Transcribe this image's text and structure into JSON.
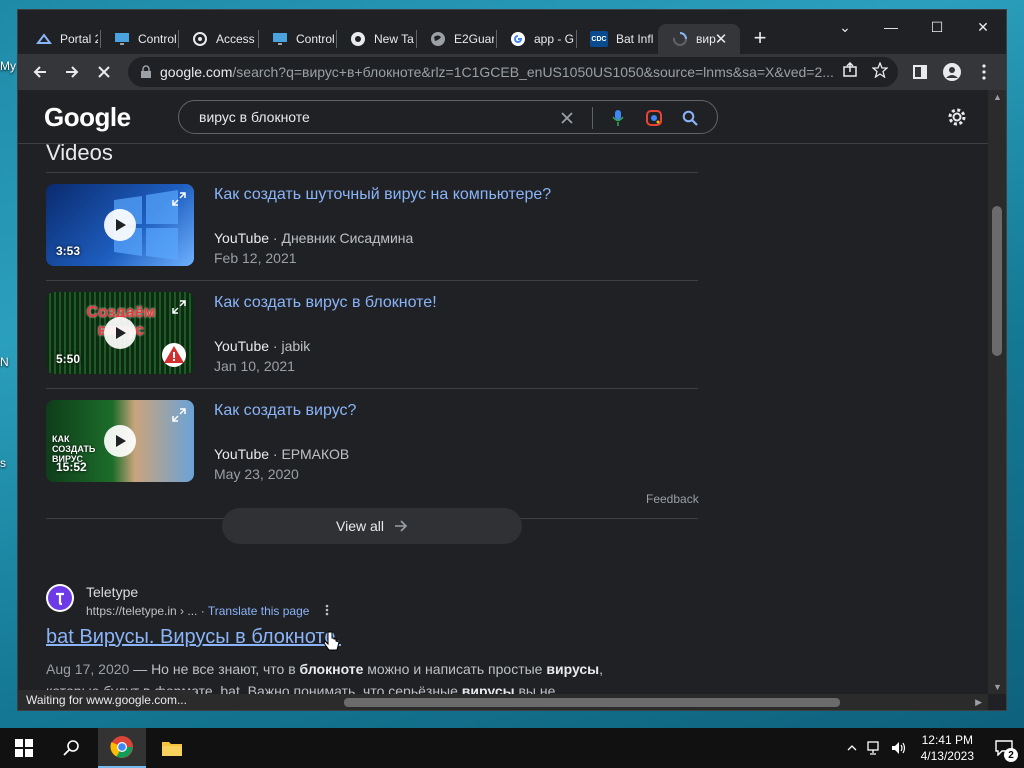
{
  "desktop": {
    "frag_1": "My",
    "frag_2": "N",
    "frag_3": "s"
  },
  "tabs": [
    {
      "label": "Portal 2",
      "icon": "portal-icon"
    },
    {
      "label": "Control",
      "icon": "monitor-icon"
    },
    {
      "label": "Access",
      "icon": "access-icon"
    },
    {
      "label": "Control",
      "icon": "monitor-icon"
    },
    {
      "label": "New Ta",
      "icon": "chrome-icon"
    },
    {
      "label": "E2Guar",
      "icon": "globe-icon"
    },
    {
      "label": "app - G",
      "icon": "google-g-icon"
    },
    {
      "label": "Bat Infl",
      "icon": "cdc-icon",
      "icon_text": "CDC"
    },
    {
      "label": "вир",
      "icon": "loading-spinner-icon",
      "active": true
    }
  ],
  "window": {
    "minimize_symbol": "—",
    "maximize_symbol": "☐",
    "close_symbol": "✕",
    "tablist_symbol": "⌄"
  },
  "toolbar": {
    "url_host": "google.com",
    "url_rest": "/search?q=вирус+в+блокноте&rlz=1C1GCEB_enUS1050US1050&source=lnms&sa=X&ved=2..."
  },
  "google": {
    "logo": "Google",
    "query": "вирус в блокноте",
    "videos_heading": "Videos"
  },
  "videos": [
    {
      "title": "Как создать шуточный вирус на компьютере?",
      "source": "YouTube",
      "channel": "Дневник Сисадмина",
      "date": "Feb 12, 2021",
      "duration": "3:53"
    },
    {
      "title": "Как создать вирус в блокноте!",
      "source": "YouTube",
      "channel": "jabik",
      "date": "Jan 10, 2021",
      "duration": "5:50",
      "thumb_text": "Создаём вирус"
    },
    {
      "title": "Как создать вирус?",
      "source": "YouTube",
      "channel": "ЕРМАКОВ",
      "date": "May 23, 2020",
      "duration": "15:52",
      "thumb_text": "КАК СОЗДАТЬ ВИРУС"
    }
  ],
  "feedback": "Feedback",
  "view_all": "View all",
  "result": {
    "site": "Teletype",
    "url": "https://teletype.in › ...",
    "translate": "Translate this page",
    "title": "bat Вирусы. Вирусы в блокноте.",
    "date": "Aug 17, 2020",
    "snip_a": " — Но не все знают, что в ",
    "snip_b1": "блокноте",
    "snip_c": " можно и написать простые ",
    "snip_b2": "вирусы",
    "snip_d": ", которые будут в формате .bat. Важно понимать, что серьёзные ",
    "snip_b3": "вирусы",
    "snip_e": " вы не ..."
  },
  "status_bar": "Waiting for www.google.com...",
  "taskbar": {
    "time": "12:41 PM",
    "date": "4/13/2023",
    "notifications": "2"
  }
}
